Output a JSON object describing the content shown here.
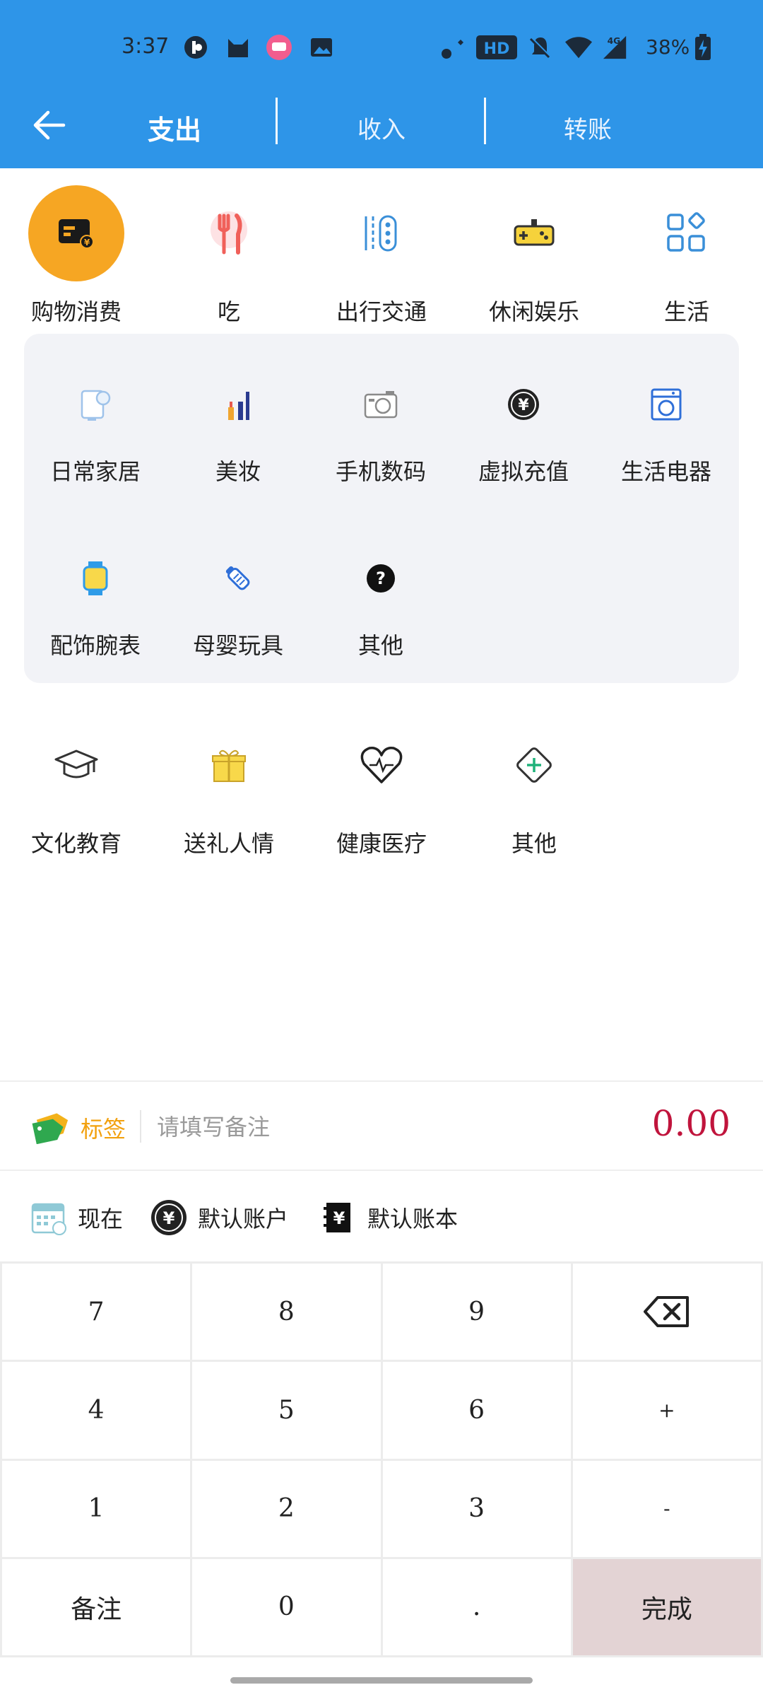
{
  "status_bar": {
    "time": "3:37",
    "hd": "HD",
    "net": "4G",
    "battery": "38%"
  },
  "nav": {
    "tabs": [
      {
        "label": "支出",
        "active": true
      },
      {
        "label": "收入",
        "active": false
      },
      {
        "label": "转账",
        "active": false
      }
    ]
  },
  "categories": [
    {
      "label": "购物消费",
      "icon": "shopping-card-icon",
      "selected": true
    },
    {
      "label": "吃",
      "icon": "fork-knife-icon",
      "selected": false
    },
    {
      "label": "出行交通",
      "icon": "transport-icon",
      "selected": false
    },
    {
      "label": "休闲娱乐",
      "icon": "gamepad-icon",
      "selected": false
    },
    {
      "label": "生活",
      "icon": "grid-apps-icon",
      "selected": false
    }
  ],
  "subcategories": [
    {
      "label": "日常家居",
      "icon": "tissue-roll-icon"
    },
    {
      "label": "美妆",
      "icon": "makeup-icon"
    },
    {
      "label": "手机数码",
      "icon": "camera-icon"
    },
    {
      "label": "虚拟充值",
      "icon": "yen-coin-icon"
    },
    {
      "label": "生活电器",
      "icon": "washing-machine-icon"
    },
    {
      "label": "配饰腕表",
      "icon": "watch-icon"
    },
    {
      "label": "母婴玩具",
      "icon": "baby-bottle-icon"
    },
    {
      "label": "其他",
      "icon": "question-icon"
    }
  ],
  "more_categories": [
    {
      "label": "文化教育",
      "icon": "graduation-cap-icon"
    },
    {
      "label": "送礼人情",
      "icon": "gift-icon"
    },
    {
      "label": "健康医疗",
      "icon": "heart-pulse-icon"
    },
    {
      "label": "其他",
      "icon": "diamond-plus-icon"
    }
  ],
  "memo": {
    "tag_label": "标签",
    "placeholder": "请填写备注",
    "amount": "0.00"
  },
  "options": {
    "time": "现在",
    "account": "默认账户",
    "book": "默认账本"
  },
  "keypad": {
    "keys": [
      "7",
      "8",
      "9",
      "⌫",
      "4",
      "5",
      "6",
      "+",
      "1",
      "2",
      "3",
      "-",
      "备注",
      "0",
      ".",
      "完成"
    ]
  },
  "colors": {
    "header": "#2e95e8",
    "selected_category": "#f6a623",
    "amount": "#c0143c",
    "tag": "#f2a10f",
    "done_key": "#e3d3d4"
  }
}
